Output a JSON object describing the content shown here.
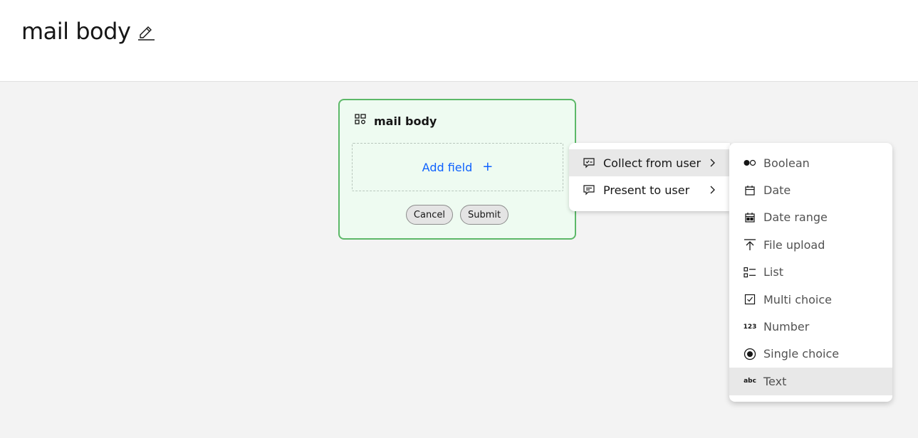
{
  "header": {
    "title": "mail body",
    "edit_icon": "pencil-icon"
  },
  "form_card": {
    "title": "mail body",
    "icon": "form-icon",
    "add_field_label": "Add field",
    "add_field_icon": "+",
    "cancel_label": "Cancel",
    "submit_label": "Submit",
    "border_color": "#5cb868",
    "background_color": "#eefbf1"
  },
  "menu": {
    "items": [
      {
        "label": "Collect from user",
        "icon": "collect-icon",
        "active": true
      },
      {
        "label": "Present to user",
        "icon": "present-icon",
        "active": false
      }
    ]
  },
  "submenu": {
    "items": [
      {
        "label": "Boolean",
        "icon": "toggle-icon"
      },
      {
        "label": "Date",
        "icon": "calendar-icon"
      },
      {
        "label": "Date range",
        "icon": "calendar-range-icon"
      },
      {
        "label": "File upload",
        "icon": "upload-icon"
      },
      {
        "label": "List",
        "icon": "list-icon"
      },
      {
        "label": "Multi choice",
        "icon": "checkbox-icon"
      },
      {
        "label": "Number",
        "icon": "number-icon",
        "glyph": "123"
      },
      {
        "label": "Single choice",
        "icon": "radio-icon"
      },
      {
        "label": "Text",
        "icon": "text-icon",
        "glyph": "abc",
        "active": true
      }
    ]
  },
  "colors": {
    "accent_link": "#0f62fe",
    "canvas_bg": "#f3f3f3",
    "hover_bg": "#e8e8e8"
  }
}
